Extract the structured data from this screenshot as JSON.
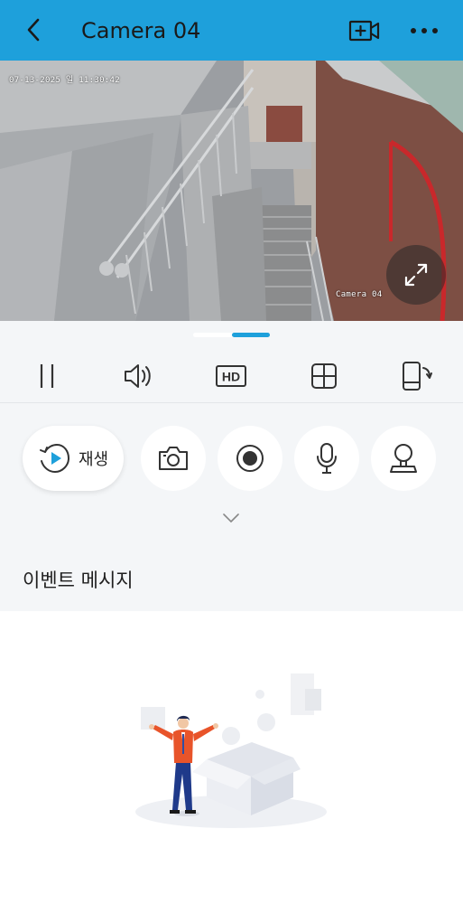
{
  "header": {
    "title": "Camera 04",
    "back_icon": "back-chevron-icon",
    "add_video_icon": "add-video-icon",
    "more_icon": "more-icon",
    "background": "#1ea0db"
  },
  "video": {
    "timestamp": "07-13-2025 일 11:30:42",
    "camera_label": "Camera 04",
    "fullscreen_icon": "fullscreen-icon"
  },
  "page_indicator": {
    "current": 2,
    "total": 2,
    "accent": "#1ea0db"
  },
  "toolbar": {
    "items": [
      {
        "name": "pause",
        "icon": "pause-icon"
      },
      {
        "name": "volume",
        "icon": "volume-icon"
      },
      {
        "name": "hd",
        "icon": "hd-icon",
        "label": "HD"
      },
      {
        "name": "split",
        "icon": "grid-icon"
      },
      {
        "name": "rotate",
        "icon": "phone-rotate-icon"
      }
    ]
  },
  "controls": {
    "playback_label": "재생",
    "playback_icon": "playback-icon",
    "buttons": [
      {
        "name": "snapshot",
        "icon": "camera-icon"
      },
      {
        "name": "record",
        "icon": "record-icon"
      },
      {
        "name": "talk",
        "icon": "microphone-icon"
      },
      {
        "name": "ptz",
        "icon": "ptz-icon"
      }
    ],
    "expand_icon": "chevron-down-icon"
  },
  "events": {
    "title": "이벤트 메시지",
    "empty_illustration": "empty-box-illustration"
  }
}
